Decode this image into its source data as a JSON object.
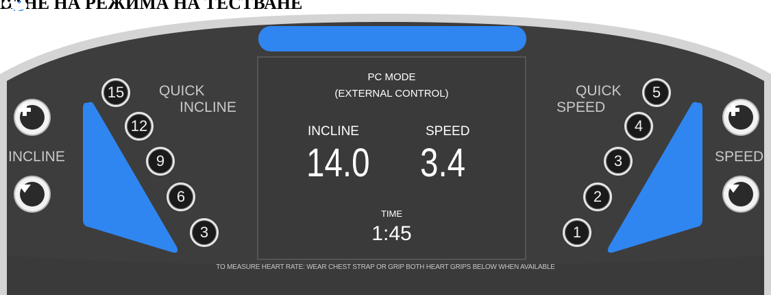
{
  "document": {
    "heading": "ВАНЕ НА РЕЖИМА НА ТЕСТВАНЕ"
  },
  "display": {
    "mode_line1": "PC MODE",
    "mode_line2": "(EXTERNAL CONTROL)",
    "incline_label": "INCLINE",
    "incline_value": "14.0",
    "speed_label": "SPEED",
    "speed_value": "3.4",
    "time_label": "TIME",
    "time_value": "1:45"
  },
  "incline_controls": {
    "label": "INCLINE",
    "quick_label_line1": "QUICK",
    "quick_label_line2": "INCLINE",
    "quick_buttons": [
      "15",
      "12",
      "9",
      "6",
      "3"
    ]
  },
  "speed_controls": {
    "label": "SPEED",
    "quick_label_line1": "QUICK",
    "quick_label_line2": "SPEED",
    "quick_buttons": [
      "5",
      "4",
      "3",
      "2",
      "1"
    ]
  },
  "footer": {
    "heart_rate_note": "TO MEASURE HEART RATE: WEAR CHEST STRAP OR GRIP BOTH HEART GRIPS BELOW WHEN AVAILABLE"
  },
  "icons": {
    "top_tab": "reading-person-icon",
    "incline_panel": "hiker-incline-icon",
    "speed_panel": "runner-icon",
    "increase": "plus-icon",
    "decrease": "minus-icon"
  },
  "colors": {
    "console_bg": "#3d3d3d",
    "bezel": "#d9d9d9",
    "accent_blue": "#2f86f0",
    "display_bg": "#3a3a3a"
  }
}
